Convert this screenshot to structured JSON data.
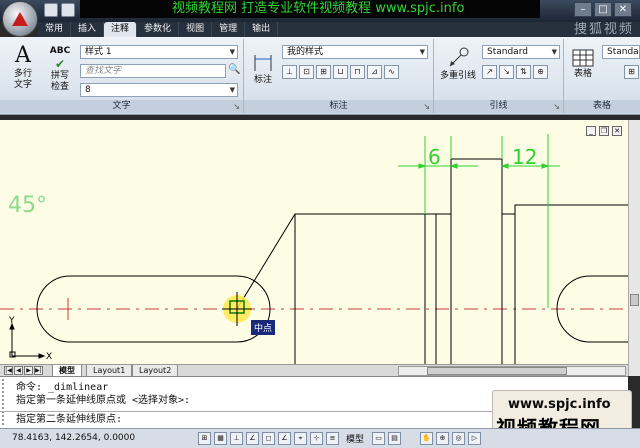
{
  "banner": "视频教程网 打造专业软件视频教程  www.spjc.info",
  "window_controls": [
    "–",
    "□",
    "✕"
  ],
  "tabs": [
    "常用",
    "插入",
    "注释",
    "参数化",
    "视图",
    "管理",
    "输出"
  ],
  "active_tab": "注释",
  "tab_extra": "捜狐视频",
  "ribbon": {
    "text_panel": {
      "title": "文字",
      "multiline_text": "多行\n文字",
      "spellcheck": "拼写\n检查",
      "abc": "ABC",
      "text_style": "样式 1",
      "find_text_placeholder": "查找文字",
      "text_height": "8"
    },
    "dim_panel": {
      "title": "标注",
      "dim_button": "标注",
      "dim_style": "我的样式"
    },
    "leader_panel": {
      "title": "引线",
      "multileader": "多重引线",
      "leader_style": "Standard"
    },
    "table_panel": {
      "title": "表格",
      "table_button": "表格",
      "table_style": "Standard"
    }
  },
  "drawing": {
    "angle_label": "45°",
    "dim_left": "6",
    "dim_right": "12",
    "snap_tooltip": "中点",
    "ucs_y": "Y",
    "ucs_x": "X"
  },
  "layout_tabs": [
    "模型",
    "Layout1",
    "Layout2"
  ],
  "active_layout": "模型",
  "command_lines": [
    "命令:  _dimlinear",
    "指定第一条延伸线原点或 <选择对象>:",
    "指定第二条延伸线原点:"
  ],
  "watermark": {
    "url": "www.spjc.info",
    "title": "视频教程网"
  },
  "status": {
    "coords": "78.4163,  142.2654, 0.0000",
    "model_label": "模型"
  },
  "colors": {
    "drawing_bg": "#fdfde5",
    "dimension": "#2fd12f",
    "centerline": "#c83a3a",
    "banner_text": "#2fd435"
  }
}
